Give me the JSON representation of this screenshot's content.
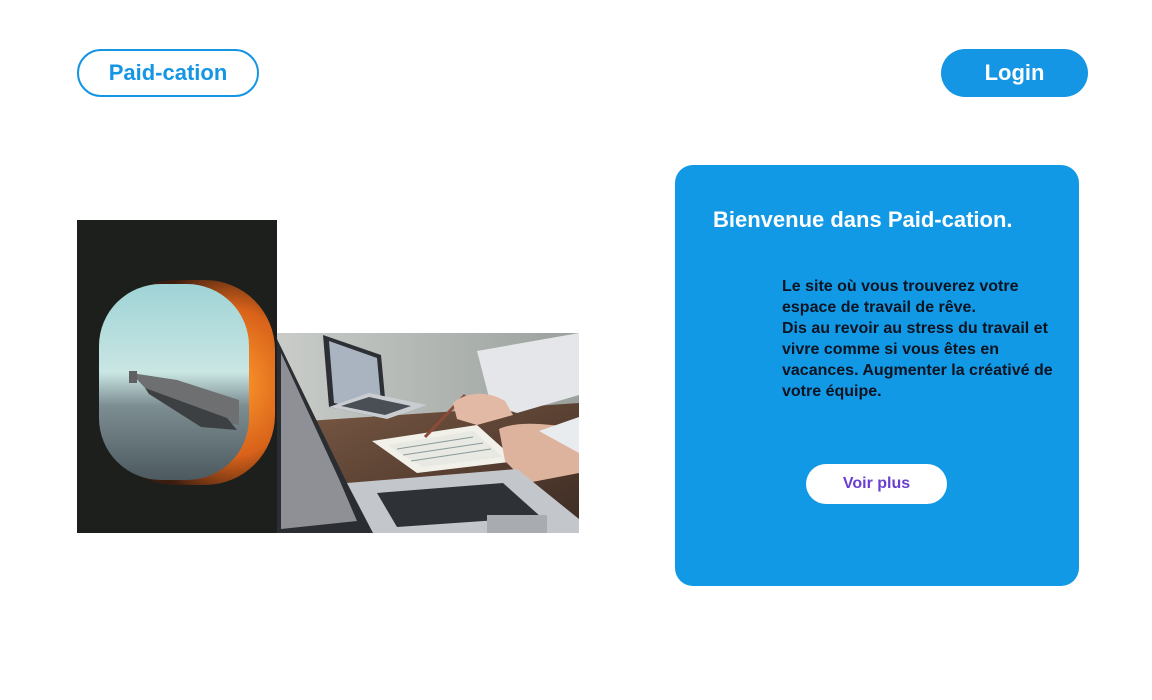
{
  "header": {
    "brand_label": "Paid-cation",
    "login_label": "Login"
  },
  "welcome": {
    "title": "Bienvenue dans Paid-cation.",
    "lines": [
      "Le site où vous trouverez votre espace de travail de rêve.",
      "Dis au revoir au stress du travail et vivre comme si vous êtes en vacances. Augmenter la créativé de votre équipe."
    ],
    "button_label": "Voir plus"
  },
  "photos": {
    "window_image": "airplane-window-photo",
    "desk_image": "laptops-desk-photo"
  },
  "colors": {
    "primary": "#1596e4",
    "card": "#1199e5",
    "button_text": "#6a3fd0",
    "body_text": "#0d1320"
  }
}
